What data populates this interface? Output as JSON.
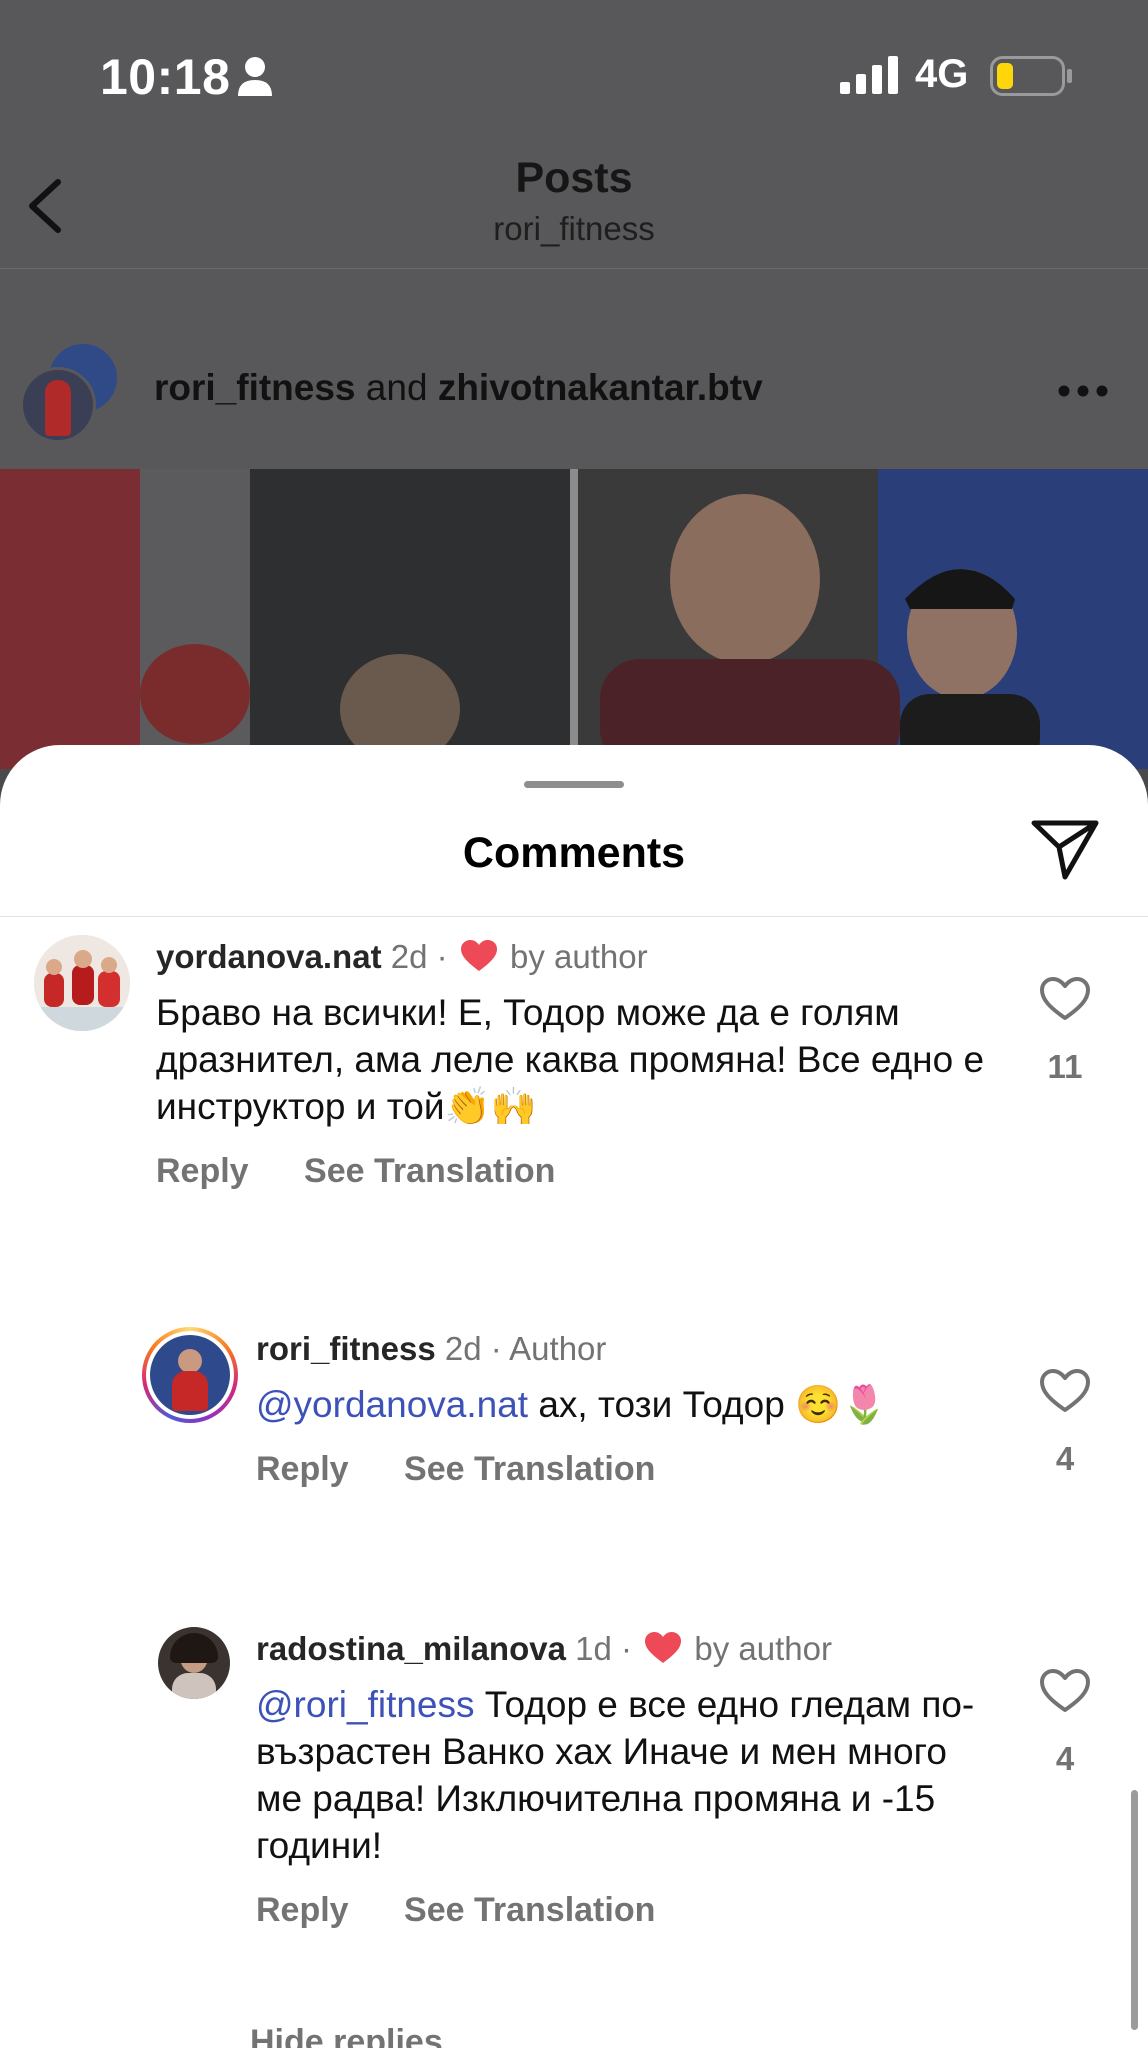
{
  "status_bar": {
    "time": "10:18",
    "network": "4G",
    "battery_color": "#ffd60a"
  },
  "header": {
    "title": "Posts",
    "subtitle": "rori_fitness"
  },
  "post": {
    "author": "rori_fitness",
    "conjunction": "and",
    "coauthor": "zhivotnakantar.btv"
  },
  "sheet": {
    "title": "Comments"
  },
  "comments": [
    {
      "username": "yordanova.nat",
      "time": "2d",
      "separator": "·",
      "badge": "by author",
      "text": "Браво на всички! Е, Тодор може да е голям дразнител, ама леле каква промяна! Все едно е инструктор и той👏🙌",
      "reply": "Reply",
      "translate": "See Translation",
      "likes": "11"
    },
    {
      "username": "rori_fitness",
      "time": "2d",
      "separator": "·",
      "badge": "Author",
      "mention": "@yordanova.nat",
      "text": " ах, този Тодор ☺️🌷",
      "reply": "Reply",
      "translate": "See Translation",
      "likes": "4"
    },
    {
      "username": "radostina_milanova",
      "time": "1d",
      "separator": "·",
      "badge": "by author",
      "mention": "@rori_fitness",
      "text": " Тодор е все едно гледам по-възрастен Ванко хах Иначе и мен много ме радва! Изключителна промяна и -15 години!",
      "reply": "Reply",
      "translate": "See Translation",
      "likes": "4"
    }
  ],
  "hide_replies": "Hide replies",
  "colors": {
    "like_red": "#ed4956",
    "mention_blue": "#3d52b8",
    "secondary_text": "#737373"
  }
}
